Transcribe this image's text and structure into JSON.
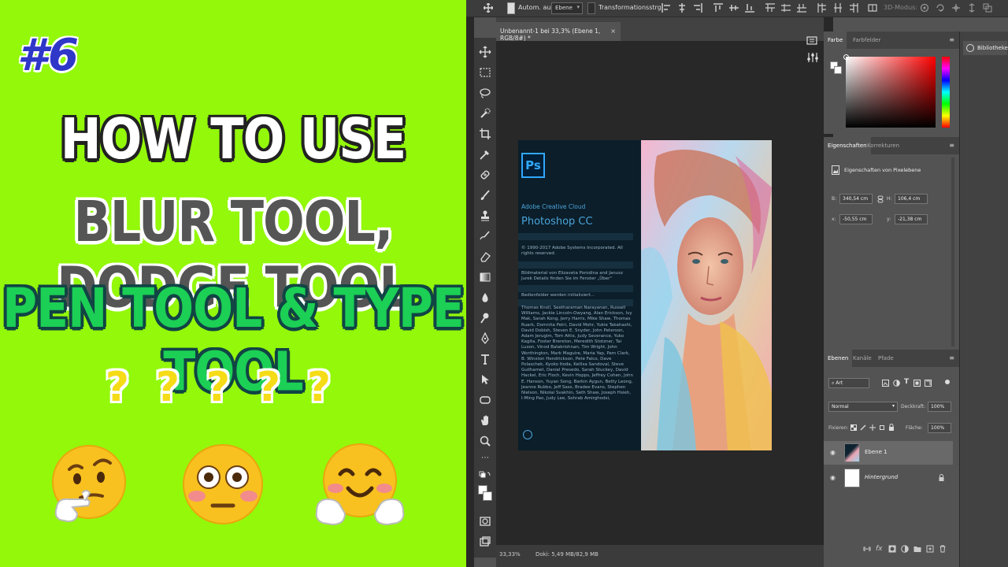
{
  "thumbnail": {
    "episode": "#6",
    "line1": "HOW TO USE",
    "line2": "BLUR TOOL, DODGE TOOL",
    "line3": "PEN TOOL & TYPE TOOL",
    "question_marks": [
      "?",
      "?",
      "?",
      "?",
      "?"
    ],
    "emojis": [
      "thinking-face",
      "flushed-face",
      "hugging-face"
    ],
    "colors": {
      "background": "#93f80a",
      "episode": "#2f37c9",
      "line1": "#ffffff",
      "line2": "#555555",
      "line3": "#1ccf55",
      "question": "#f5dc17"
    }
  },
  "options_bar": {
    "tool_icon": "move-icon",
    "auto_select_label": "Autom. ausw.:",
    "auto_select_value": "Ebene",
    "transform_label": "Transformationsstrg.",
    "mode_3d_label": "3D-Modus:"
  },
  "document": {
    "tab_title": "Unbenannt-1 bei 33,3% (Ebene 1, RGB/8#) *",
    "zoom": "33,33%",
    "doc_info": "Doki: 5,49 MB/82,9 MB"
  },
  "splash": {
    "logo": "Ps",
    "brand": "Adobe Creative Cloud",
    "product": "Photoshop CC",
    "copyright": "© 1990-2017 Adobe Systems Incorporated. All rights reserved.",
    "artwork_credit": "Bildmaterial von Elizaveta Porodina and Janusz Jurek Details finden Sie im Fenster „Über\"",
    "status": "Bedienfelder werden initialisiert...",
    "credits": "Thomas Knoll, Seetharaman Narayanan, Russell Williams, Jackie Lincoln-Owyang, Alan Erickson, Ivy Mak, Sarah Kong, Jerry Harris, Mike Shaw, Thomas Ruark, Domnita Petri, David Mohr, Yukie Takahashi, David Dobish, Steven E. Snyder, John Peterson, Adam Jerugim, Tom Attix, Judy Severance, Yuko Kagita, Foster Brereton, Meredith Stotzner, Tai Luxon, Vinod Balakrishnan, Tim Wright, John Worthington, Mark Maguire, Maria Yap, Pam Clark, B. Winston Hendrickson, Pete Falco, Dave Polaschek, Kyoko Itoda, Kellisa Sandoval, Steve Guilhamet, Daniel Presedo, Sarah Stuckey, David Hackel, Eric Floch, Kevin Hopps, Jeffrey Cohen, John E. Hanson, Yuyan Song, Barkin Aygun, Betty Leong, Jeanne Rubbo, Jeff Sass, Bradee Evans, Stephen Nielson, Nikolai Svakhin, Seth Shaw, Joseph Hsieh, I-Ming Pao, Judy Lee, Sohrab Amirghodsi,"
  },
  "color_panel": {
    "tabs": [
      "Farbe",
      "Farbfelder"
    ],
    "hue": "#ff0000"
  },
  "properties_panel": {
    "tabs": [
      "Eigenschaften",
      "Korrekturen"
    ],
    "subtitle": "Eigenschaften von Pixelebene",
    "w_label": "B:",
    "w_value": "340,54 cm",
    "h_label": "H:",
    "h_value": "106,4 cm",
    "x_label": "x:",
    "x_value": "-50,55 cm",
    "y_label": "y:",
    "y_value": "-21,38 cm"
  },
  "layers_panel": {
    "tabs": [
      "Ebenen",
      "Kanäle",
      "Pfade"
    ],
    "filter_label": "Art",
    "blend_mode": "Normal",
    "opacity_label": "Deckkraft:",
    "opacity_value": "100%",
    "lock_label": "Fixieren:",
    "fill_label": "Fläche:",
    "fill_value": "100%",
    "layers": [
      {
        "name": "Ebene 1",
        "selected": true
      },
      {
        "name": "Hintergrund",
        "selected": false,
        "locked": true
      }
    ]
  },
  "libraries": {
    "label": "Bibliotheken"
  }
}
